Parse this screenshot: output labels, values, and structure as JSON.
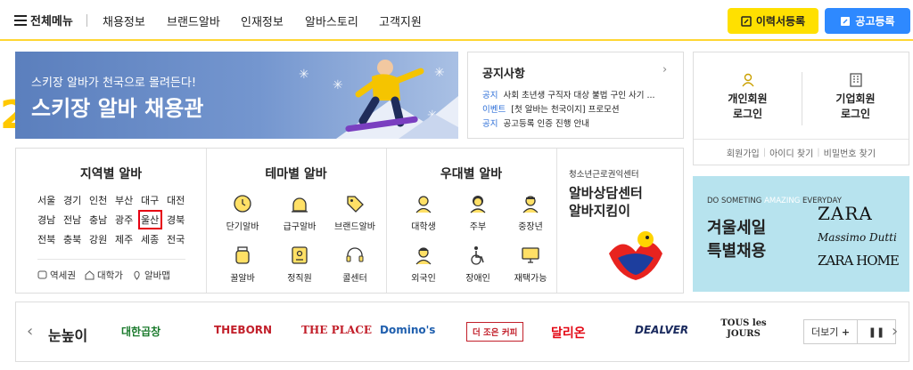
{
  "header": {
    "menu_all": "전체메뉴",
    "nav": [
      "채용정보",
      "브랜드알바",
      "인재정보",
      "알바스토리",
      "고객지원"
    ],
    "resume_btn": "이력서등록",
    "post_btn": "공고등록"
  },
  "banner": {
    "sub": "스키장 알바가 천국으로 몰려든다!",
    "main": "스키장 알바 채용관"
  },
  "notice": {
    "title": "공지사항",
    "items": [
      {
        "cat": "공지",
        "text": "사회 초년생 구직자 대상 불법 구인 사기 ..."
      },
      {
        "cat": "이벤트",
        "text": "[첫 알바는 천국이지] 프로모션"
      },
      {
        "cat": "공지",
        "text": "공고등록 인증 진행 안내"
      }
    ]
  },
  "login": {
    "personal": [
      "개인회원",
      "로그인"
    ],
    "company": [
      "기업회원",
      "로그인"
    ],
    "links": [
      "회원가입",
      "아이디 찾기",
      "비밀번호 찾기"
    ]
  },
  "regions": {
    "title": "지역별 알바",
    "rows": [
      [
        "서울",
        "경기",
        "인천",
        "부산",
        "대구",
        "대전"
      ],
      [
        "경남",
        "전남",
        "충남",
        "광주",
        "울산",
        "경북"
      ],
      [
        "전북",
        "충북",
        "강원",
        "제주",
        "세종",
        "전국"
      ]
    ],
    "selected": "울산",
    "footer": [
      "역세권",
      "대학가",
      "알바맵"
    ]
  },
  "themes": {
    "title": "테마별 알바",
    "items": [
      "단기알바",
      "급구알바",
      "브랜드알바",
      "꿀알바",
      "정직원",
      "콜센터"
    ]
  },
  "benefits": {
    "title": "우대별 알바",
    "items": [
      "대학생",
      "주부",
      "중장년",
      "외국인",
      "장애인",
      "재택가능"
    ]
  },
  "counsel": {
    "small": "청소년근로권익센터",
    "big": [
      "알바상담센터",
      "알바지킴이"
    ]
  },
  "zara": {
    "top_a": "DO SOMETING ",
    "top_b": "AMAZING",
    "top_c": " EVERYDAY",
    "main": [
      "겨울세일",
      "특별채용"
    ],
    "brands": [
      "ZARA",
      "Massimo Dutti",
      "ZARA HOME"
    ]
  },
  "brands": {
    "items": [
      "눈높이",
      "대한곱창",
      "THEBORN",
      "THE PLACE",
      "Domino's",
      "더 조은 커피",
      "달리온",
      "DEALVER",
      "TOUS les JOURS"
    ],
    "more": "더보기"
  },
  "accent": "2",
  "colors": {
    "yellow": "#ffe000",
    "blue": "#2e89ff",
    "link": "#2e6fd8",
    "highlight": "#e60012"
  }
}
